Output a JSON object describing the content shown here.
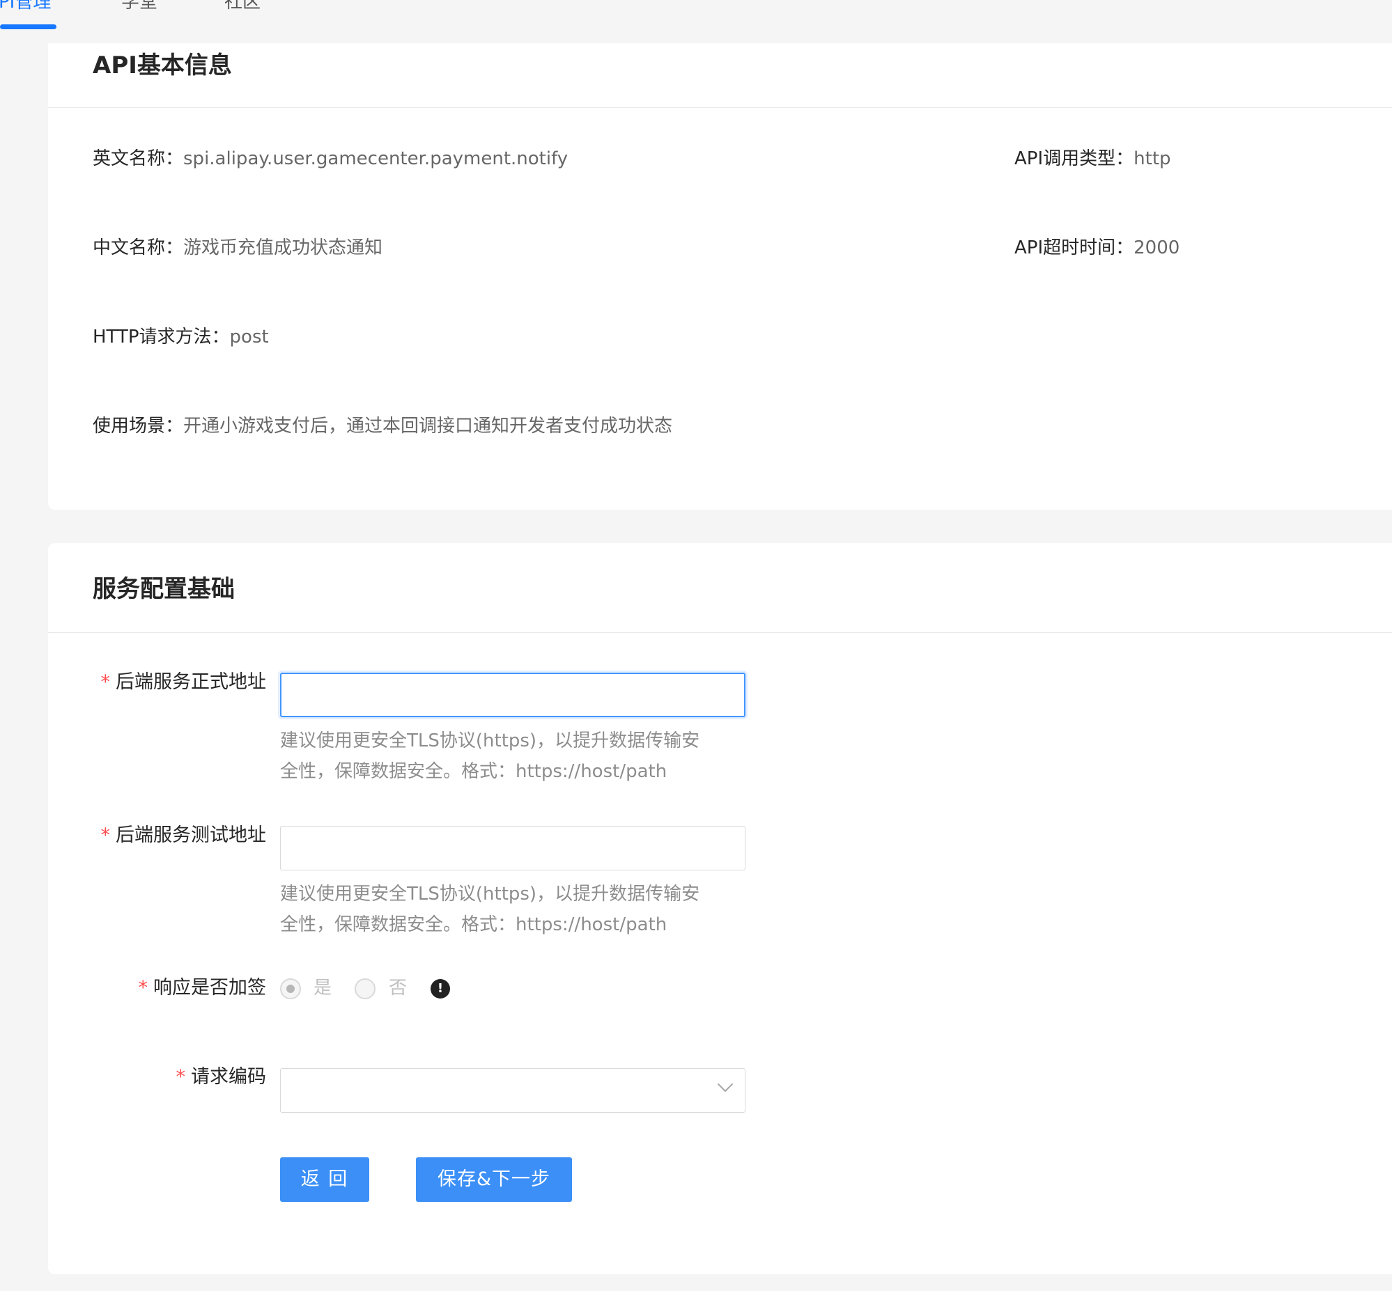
{
  "tabs": [
    {
      "label": "PI管理",
      "active": true
    },
    {
      "label": "学堂",
      "active": false
    },
    {
      "label": "社区",
      "active": false
    }
  ],
  "basic_info": {
    "title": "API基本信息",
    "english_name": {
      "label": "英文名称：",
      "value": "spi.alipay.user.gamecenter.payment.notify"
    },
    "chinese_name": {
      "label": "中文名称：",
      "value": "游戏币充值成功状态通知"
    },
    "http_method": {
      "label": "HTTP请求方法：",
      "value": "post"
    },
    "usage_scenario": {
      "label": "使用场景：",
      "value": "开通小游戏支付后，通过本回调接口通知开发者支付成功状态"
    },
    "call_type": {
      "label": "API调用类型：",
      "value": "http"
    },
    "timeout": {
      "label": "API超时时间：",
      "value": "2000"
    }
  },
  "service_config": {
    "title": "服务配置基础",
    "required_mark": "*",
    "prod_url": {
      "label": "后端服务正式地址",
      "value": "",
      "help_line1": "建议使用更安全TLS协议(https)，以提升数据传输安",
      "help_line2": "全性，保障数据安全。格式：https://host/path"
    },
    "test_url": {
      "label": "后端服务测试地址",
      "value": "",
      "help_line1": "建议使用更安全TLS协议(https)，以提升数据传输安",
      "help_line2": "全性，保障数据安全。格式：https://host/path"
    },
    "response_sign": {
      "label": "响应是否加签",
      "options": [
        "是",
        "否"
      ],
      "selected": "是",
      "info_glyph": "!"
    },
    "request_encoding": {
      "label": "请求编码",
      "value": ""
    },
    "back_button": "返 回",
    "next_button": "保存&下一步"
  },
  "colors": {
    "primary": "#1677ff",
    "button": "#3b8ff7",
    "required": "#ff4d4f",
    "background": "#f5f5f5"
  }
}
